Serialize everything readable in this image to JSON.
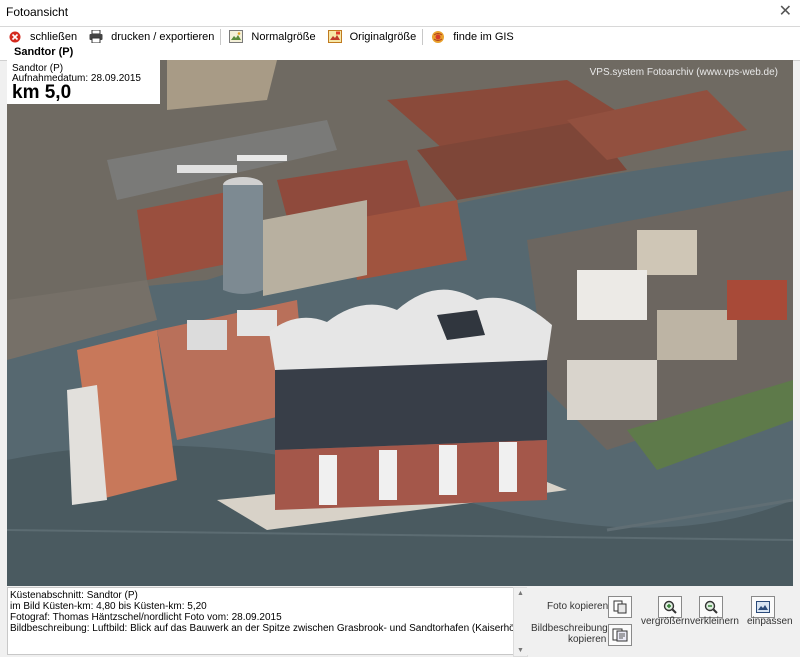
{
  "window": {
    "title": "Fotoansicht",
    "close_glyph": "✕"
  },
  "toolbar": {
    "close_label": "schließen",
    "print_label": "drucken / exportieren",
    "normal_size_label": "Normalgröße",
    "original_size_label": "Originalgröße",
    "gis_label": "finde im GIS"
  },
  "path": {
    "label": "Sandtor (P)"
  },
  "photo": {
    "overlay": {
      "location": "Sandtor (P)",
      "date_line": "Aufnahmedatum: 28.09.2015",
      "km_label": "km 5,0"
    },
    "watermark": "VPS.system Fotoarchiv  (www.vps-web.de)"
  },
  "info": {
    "lines": [
      "Küstenabschnitt: Sandtor (P)",
      "im Bild Küsten-km: 4,80   bis Küsten-km: 5,20",
      "Fotograf: Thomas Häntzschel/nordlicht   Foto vom: 28.09.2015",
      "Bildbeschreibung: Luftbild: Blick  auf das Bauwerk an der Spitze zwischen Grasbrook- und Sandtorhafen (Kaiserhöft);"
    ]
  },
  "panel": {
    "copy_photo_label": "Foto kopieren",
    "copy_description_label_1": "Bildbeschreibung",
    "copy_description_label_2": "kopieren",
    "zoom_in_label": "vergrößern",
    "zoom_out_label": "verkleinern",
    "fit_label": "einpassen"
  },
  "colors": {
    "water": "#4a5a60",
    "brick": "#a65a45",
    "glass": "#3a4048",
    "roof": "#e4e4e4"
  }
}
